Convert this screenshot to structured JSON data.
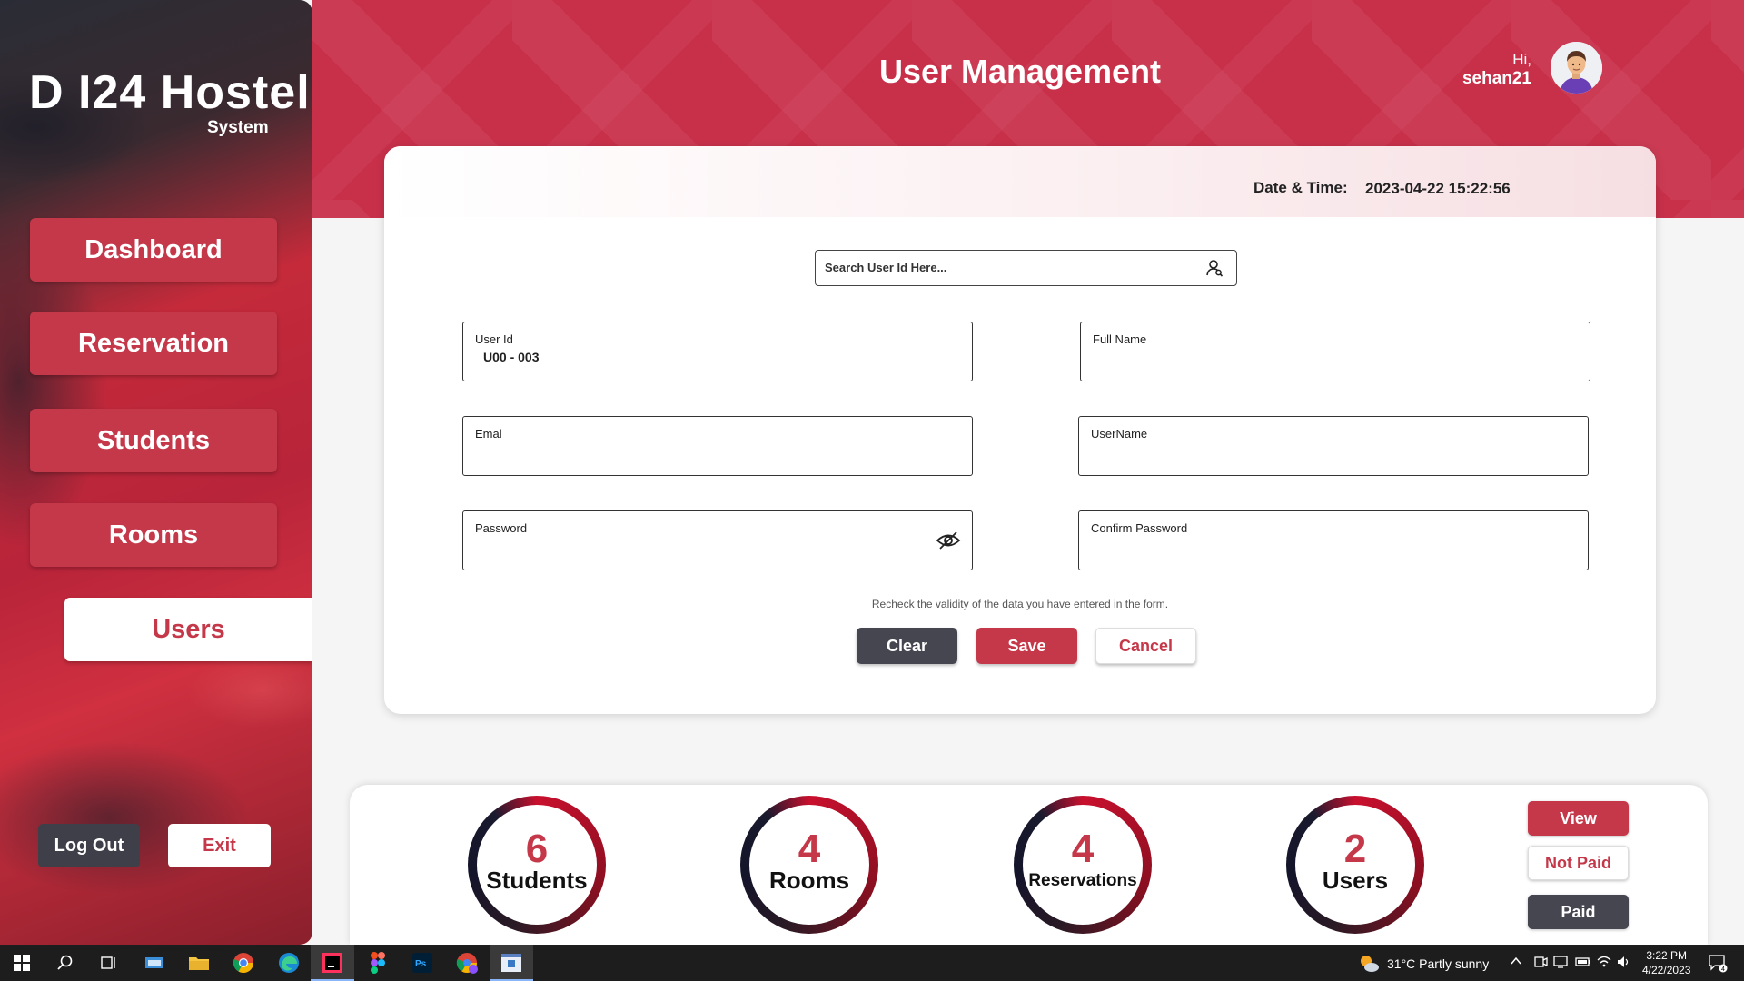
{
  "app": {
    "logo_main": "D I24 Hostel",
    "logo_sub": "System"
  },
  "sidebar": {
    "items": [
      {
        "label": "Dashboard"
      },
      {
        "label": "Reservation"
      },
      {
        "label": "Students"
      },
      {
        "label": "Rooms"
      },
      {
        "label": "Users"
      }
    ],
    "active": "Users",
    "logout_label": "Log Out",
    "exit_label": "Exit"
  },
  "header": {
    "title": "User Management",
    "greeting": "Hi,",
    "username": "sehan21"
  },
  "form": {
    "datetime_label": "Date & Time:",
    "datetime_value": "2023-04-22 15:22:56",
    "search_placeholder": "Search User Id Here...",
    "fields": {
      "user_id": {
        "label": "User Id",
        "value": "U00 - 003"
      },
      "full_name": {
        "label": "Full Name",
        "value": ""
      },
      "email": {
        "label": "Emal",
        "value": ""
      },
      "username": {
        "label": "UserName",
        "value": ""
      },
      "password": {
        "label": "Password",
        "value": ""
      },
      "confirm_password": {
        "label": "Confirm Password",
        "value": ""
      }
    },
    "hint": "Recheck the validity of the data you have entered in the form.",
    "clear_label": "Clear",
    "save_label": "Save",
    "cancel_label": "Cancel"
  },
  "stats": {
    "students": {
      "count": "6",
      "label": "Students"
    },
    "rooms": {
      "count": "4",
      "label": "Rooms"
    },
    "reservations": {
      "count": "4",
      "label": "Reservations"
    },
    "users": {
      "count": "2",
      "label": "Users"
    },
    "view_label": "View",
    "not_paid_label": "Not Paid",
    "paid_label": "Paid"
  },
  "taskbar": {
    "weather": "31°C  Partly sunny",
    "time": "3:22 PM",
    "date": "4/22/2023",
    "notification_count": "4"
  },
  "colors": {
    "accent": "#c4384a",
    "header": "#c8304a",
    "dark_button": "#464651"
  }
}
